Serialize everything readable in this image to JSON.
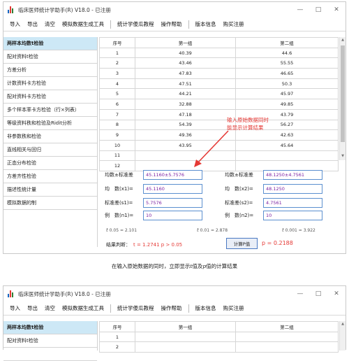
{
  "window": {
    "title": "临床医师统计学助手(R) V18.0 - 已注册",
    "controls": [
      "—",
      "□",
      "✕"
    ]
  },
  "menu": [
    "导入",
    "导出",
    "清空",
    "模拟数据生成工具",
    "统计学傻瓜教程",
    "操作帮助",
    "版本信息",
    "购买注册"
  ],
  "sidebar": {
    "items": [
      "两样本均数t检验",
      "配对资料t检验",
      "方差分析",
      "计数资料卡方检验",
      "配对资料卡方检验",
      "多个样本率卡方检验（行×列表）",
      "等级资料秩和检验及Ridit分析",
      "非参数秩和检验",
      "直线相关与回归",
      "正态分布检验",
      "方差齐性检验",
      "描述性统计量",
      "模拟数据的制"
    ]
  },
  "table": {
    "headers": [
      "序号",
      "第一组",
      "第二组"
    ],
    "rows": [
      [
        "1",
        "40.39",
        "44.6"
      ],
      [
        "2",
        "43.46",
        "55.55"
      ],
      [
        "3",
        "47.83",
        "46.65"
      ],
      [
        "4",
        "47.51",
        "50.3"
      ],
      [
        "5",
        "44.21",
        "45.97"
      ],
      [
        "6",
        "32.88",
        "49.85"
      ],
      [
        "7",
        "47.18",
        "43.79"
      ],
      [
        "8",
        "54.39",
        "56.27"
      ],
      [
        "9",
        "49.36",
        "42.63"
      ],
      [
        "10",
        "43.95",
        "45.64"
      ],
      [
        "11",
        "",
        ""
      ],
      [
        "12",
        "",
        ""
      ]
    ]
  },
  "annotation": {
    "line1": "输入原始数据同时",
    "line2": "能显示计算结果"
  },
  "stats": {
    "g1": {
      "mean_sd_label": "均数±标准差",
      "mean_sd": "45.1160±5.7576",
      "mean_label": "均　数(x1)=",
      "mean": "45.1160",
      "sd_label": "标准差(s1)=",
      "sd": "5.7576",
      "n_label": "例　数(n1)=",
      "n": "10"
    },
    "g2": {
      "mean_sd_label": "均数±标准差",
      "mean_sd": "48.1250±4.7561",
      "mean_label": "均　数(x2)=",
      "mean": "48.1250",
      "sd_label": "标准差(s2)=",
      "sd": "4.7561",
      "n_label": "例　数(n2)=",
      "n": "10"
    },
    "t_values": [
      "0.05 = 2.101",
      "0.01 = 2.878",
      "0.001 = 3.922"
    ],
    "result_label": "结果判断：",
    "result_value": "t = 1.2741  p > 0.05",
    "calc_button": "计算P值",
    "p_value": "p = 0.2188"
  },
  "caption": {
    "pre": "在输入原始数据的同时，立即显示",
    "t": "t",
    "mid": "值及",
    "p": "p",
    "post": "值的计算结果"
  },
  "window2": {
    "sidebar_items": [
      "两样本均数t检验",
      "配对资料t检验",
      ""
    ],
    "rows": [
      "1",
      "2"
    ]
  },
  "colors": {
    "accent_red": "#e53935",
    "selection_blue": "#cde8f6",
    "field_border": "#5b8fcf",
    "value_purple": "#7b1fa2"
  }
}
